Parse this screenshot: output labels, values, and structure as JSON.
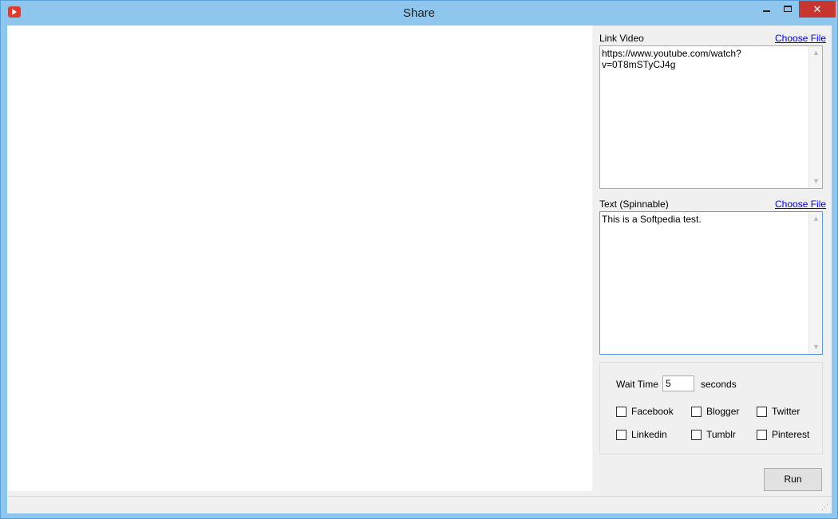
{
  "window": {
    "title": "Share",
    "close_glyph": "✕",
    "icon": "youtube-logo-icon"
  },
  "link_video": {
    "label": "Link Video",
    "choose_file": "Choose File",
    "value": "https://www.youtube.com/watch?v=0T8mSTyCJ4g"
  },
  "text_spin": {
    "label": "Text (Spinnable)",
    "choose_file": "Choose File",
    "value": "This is a Softpedia test."
  },
  "options": {
    "wait_label": "Wait Time",
    "wait_value": "5",
    "wait_unit": "seconds",
    "checkboxes": [
      {
        "label": "Facebook",
        "checked": false
      },
      {
        "label": "Blogger",
        "checked": false
      },
      {
        "label": "Twitter",
        "checked": false
      },
      {
        "label": "Linkedin",
        "checked": false
      },
      {
        "label": "Tumblr",
        "checked": false
      },
      {
        "label": "Pinterest",
        "checked": false
      }
    ]
  },
  "run_label": "Run",
  "colors": {
    "title_bg": "#8fc6ee",
    "close_bg": "#c7372f",
    "client_bg": "#f0f0f0",
    "link": "#0000ee"
  }
}
